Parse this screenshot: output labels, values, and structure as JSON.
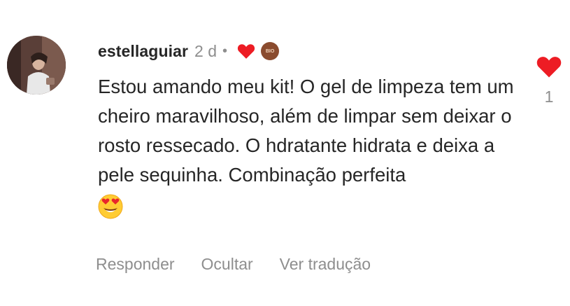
{
  "comment": {
    "username": "estellaguiar",
    "time": "2 d",
    "separator": "•",
    "text": "Estou amando meu kit! O gel de limpeza tem um cheiro maravilhoso, além de limpar sem deixar o rosto ressecado. O hdratante hidrata e deixa a pele sequinha. Combinação perfeita",
    "emoji_icon": "smiling-face-with-heart-eyes-icon",
    "creator_avatar_label": "BIO",
    "like_count": "1"
  },
  "actions": {
    "reply": "Responder",
    "hide": "Ocultar",
    "translate": "Ver tradução"
  },
  "colors": {
    "heart": "#ed1c24",
    "muted": "#8e8e8e",
    "text": "#262626"
  }
}
